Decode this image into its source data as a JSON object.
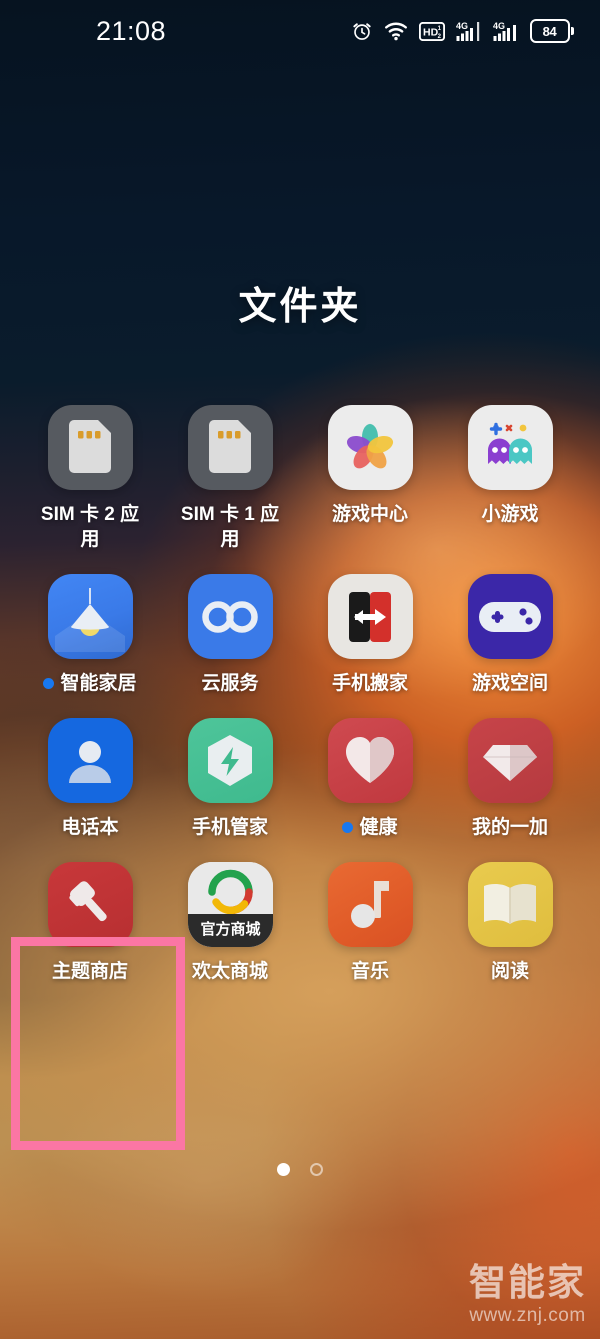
{
  "statusbar": {
    "time": "21:08",
    "battery_level": "84",
    "icons": [
      "alarm-icon",
      "wifi-icon",
      "hd-volte-icon",
      "signal-4g-sim1-icon",
      "signal-4g-sim2-icon",
      "battery-icon"
    ],
    "network_label": "4G",
    "hd_label": "HD"
  },
  "folder": {
    "title": "文件夹"
  },
  "apps": [
    {
      "name": "SIM 卡 2 应用",
      "icon": "sim-card-2-icon",
      "badge": false
    },
    {
      "name": "SIM 卡 1 应用",
      "icon": "sim-card-1-icon",
      "badge": false
    },
    {
      "name": "游戏中心",
      "icon": "game-center-icon",
      "badge": false
    },
    {
      "name": "小游戏",
      "icon": "mini-games-icon",
      "badge": false
    },
    {
      "name": "智能家居",
      "icon": "smart-home-icon",
      "badge": true
    },
    {
      "name": "云服务",
      "icon": "cloud-service-icon",
      "badge": false
    },
    {
      "name": "手机搬家",
      "icon": "phone-clone-icon",
      "badge": false
    },
    {
      "name": "游戏空间",
      "icon": "game-space-icon",
      "badge": false
    },
    {
      "name": "电话本",
      "icon": "contacts-icon",
      "badge": false
    },
    {
      "name": "手机管家",
      "icon": "phone-manager-icon",
      "badge": false
    },
    {
      "name": "健康",
      "icon": "health-icon",
      "badge": true
    },
    {
      "name": "我的一加",
      "icon": "my-oneplus-icon",
      "badge": false
    },
    {
      "name": "主题商店",
      "icon": "theme-store-icon",
      "badge": false
    },
    {
      "name": "欢太商城",
      "icon": "heytap-store-icon",
      "badge": false,
      "icon_text": "官方商城"
    },
    {
      "name": "音乐",
      "icon": "music-icon",
      "badge": false
    },
    {
      "name": "阅读",
      "icon": "reading-icon",
      "badge": false
    }
  ],
  "pagination": {
    "pages": 2,
    "current": 1
  },
  "highlight": {
    "target_app": "主题商店",
    "color": "#fb76a4"
  },
  "watermark": {
    "logo": "智能家",
    "url": "www.znj.com"
  },
  "colors": {
    "badge_blue": "#1878f0",
    "highlight_pink": "#fb76a4",
    "sim_gray": "#565a60",
    "theme_store_red": "#c23535",
    "music_orange": "#e8632a",
    "reading_yellow": "#e2c044"
  }
}
